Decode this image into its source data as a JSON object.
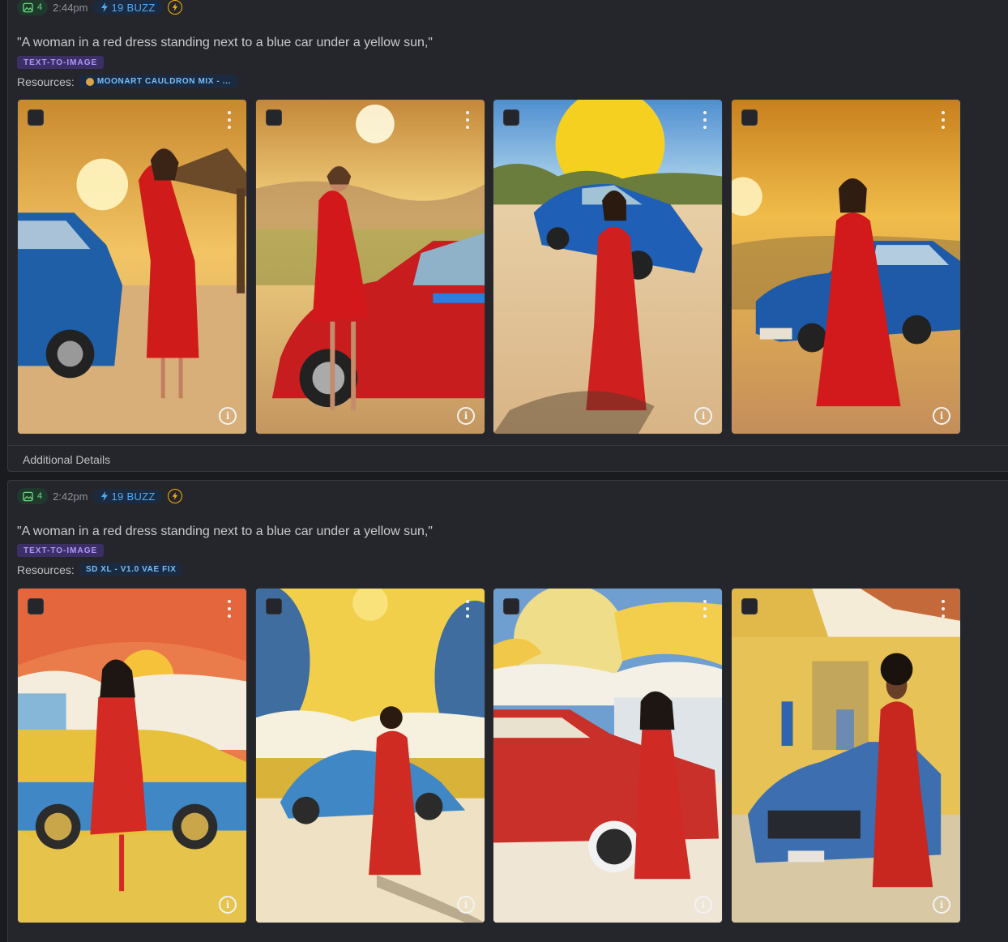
{
  "entries": [
    {
      "image_count": "4",
      "time": "2:44pm",
      "buzz": "19 BUZZ",
      "prompt": "\"A woman in a red dress standing next to a blue car under a yellow sun,\"",
      "type_tag": "TEXT-TO-IMAGE",
      "resources_label": "Resources:",
      "resource": "MOONART CAULDRON MIX - ...",
      "resource_icon": "bear-face-icon",
      "images": [
        {
          "style": "photo",
          "colors": {
            "sky": "#e9b04a",
            "ground": "#d9b07a",
            "dress": "#d01b1b",
            "car": "#1e5fa8"
          }
        },
        {
          "style": "photo",
          "colors": {
            "sky": "#f0c25a",
            "ground": "#c99a5d",
            "dress": "#d3181c",
            "car": "#c71d1f"
          }
        },
        {
          "style": "photo",
          "colors": {
            "sky": "#6aa6d6",
            "ground": "#e2c49a",
            "dress": "#cf1f1f",
            "car": "#1f5fb5"
          }
        },
        {
          "style": "photo",
          "colors": {
            "sky": "#e8a431",
            "ground": "#c99563",
            "dress": "#d21a1d",
            "car": "#1f5aa8"
          }
        }
      ],
      "details_label": "Additional Details"
    },
    {
      "image_count": "4",
      "time": "2:42pm",
      "buzz": "19 BUZZ",
      "prompt": "\"A woman in a red dress standing next to a blue car under a yellow sun,\"",
      "type_tag": "TEXT-TO-IMAGE",
      "resources_label": "Resources:",
      "resource": "SD XL - V1.0 VAE FIX",
      "images": [
        {
          "style": "illustration",
          "colors": {
            "sky": "#e97c4a",
            "ground": "#e6c34a",
            "dress": "#d42a24",
            "car": "#e8c13c"
          }
        },
        {
          "style": "illustration",
          "colors": {
            "sky": "#f1cf4b",
            "ground": "#efe2c4",
            "dress": "#cf2b22",
            "car": "#3f88c5"
          }
        },
        {
          "style": "illustration",
          "colors": {
            "sky": "#6e9fd0",
            "ground": "#efe6d6",
            "dress": "#cf2a24",
            "car": "#c9302a"
          }
        },
        {
          "style": "illustration",
          "colors": {
            "sky": "#e0b94a",
            "ground": "#d8c8a4",
            "dress": "#c8271f",
            "car": "#3d6fb0"
          }
        }
      ]
    }
  ]
}
